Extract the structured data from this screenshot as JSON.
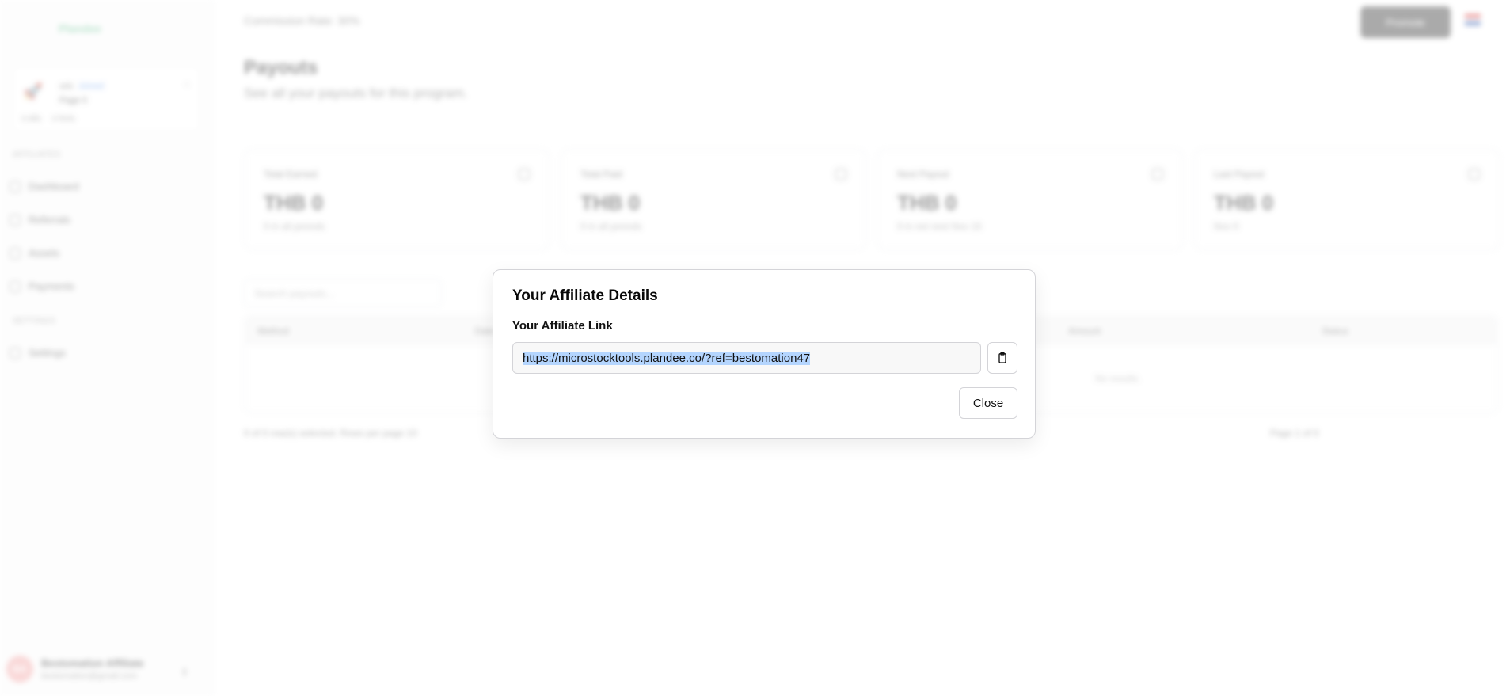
{
  "background": {
    "logo": "Plandee",
    "program": {
      "name": "ads",
      "tag": "Joined",
      "sub": "Page 0",
      "meta1": "0 Affs",
      "meta2": "0 Refs"
    },
    "sidebar": {
      "section_main": "AFFILIATES",
      "items": [
        {
          "label": "Dashboard",
          "icon": "grid-icon"
        },
        {
          "label": "Referrals",
          "icon": "link-icon"
        },
        {
          "label": "Assets",
          "icon": "folder-icon"
        },
        {
          "label": "Payments",
          "icon": "card-icon"
        }
      ],
      "section_settings": "SETTINGS",
      "settings_item": "Settings"
    },
    "user": {
      "initials": "BA",
      "name": "Bestomation Affiliate",
      "email": "bestomation@gmail.com"
    },
    "breadcrumb": "Commission Rate: 30%",
    "topbar_button": "Promote",
    "page": {
      "title": "Payouts",
      "subtitle": "See all your payouts for this program."
    },
    "stats": [
      {
        "label": "Total Earned",
        "value": "THB 0",
        "sub": "0 in all periods"
      },
      {
        "label": "Total Paid",
        "value": "THB 0",
        "sub": "0 in all periods"
      },
      {
        "label": "Next Payout",
        "value": "THB 0",
        "sub": "0 in net next Nov 15"
      },
      {
        "label": "Last Payout",
        "value": "THB 0",
        "sub": "Nov 0"
      }
    ],
    "filter_placeholder": "Search payouts...",
    "table": {
      "columns": [
        "Method",
        "Date",
        "Amount",
        "Status"
      ],
      "empty": "No results."
    },
    "pager_left": "0 of 0 row(s) selected.  Rows per page  10",
    "pager_right": "Page 1 of 0"
  },
  "modal": {
    "title": "Your Affiliate Details",
    "link_label": "Your Affiliate Link",
    "link_value": "https://microstocktools.plandee.co/?ref=bestomation47",
    "copy_icon": "clipboard-icon",
    "close_label": "Close"
  }
}
